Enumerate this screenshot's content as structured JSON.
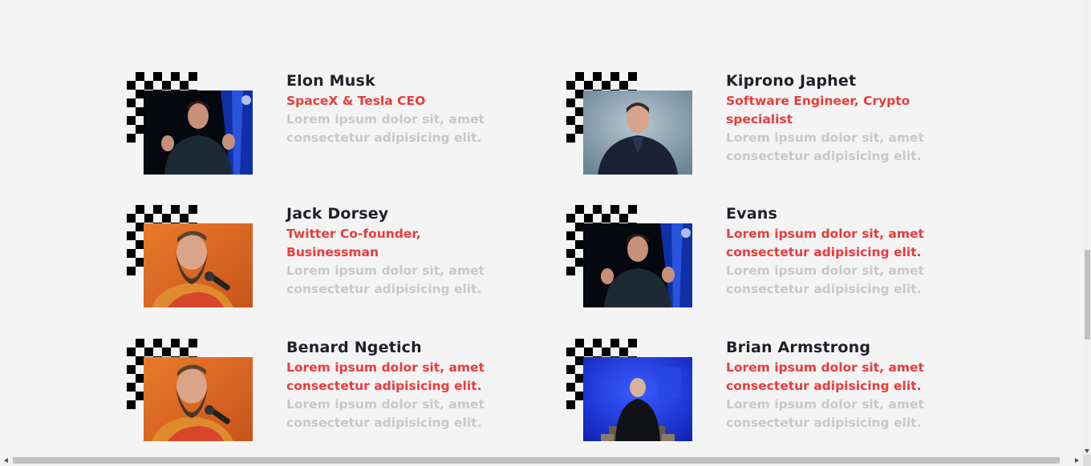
{
  "team": [
    {
      "name": "Elon Musk",
      "role": "SpaceX & Tesla CEO",
      "description": "Lorem ipsum dolor sit, amet consectetur adipisicing elit.",
      "photo": "person-on-stage-dark"
    },
    {
      "name": "Kiprono Japhet",
      "role": "Software Engineer, Crypto specialist",
      "description": "Lorem ipsum dolor sit, amet consectetur adipisicing elit.",
      "photo": "person-portrait-grey"
    },
    {
      "name": "Jack Dorsey",
      "role": "Twitter Co-founder, Businessman",
      "description": "Lorem ipsum dolor sit, amet consectetur adipisicing elit.",
      "photo": "bearded-speaker-orange"
    },
    {
      "name": "Evans",
      "role": "Lorem ipsum dolor sit, amet consectetur adipisicing elit.",
      "description": "Lorem ipsum dolor sit, amet consectetur adipisicing elit.",
      "photo": "person-on-stage-dark"
    },
    {
      "name": "Benard Ngetich",
      "role": "Lorem ipsum dolor sit, amet consectetur adipisicing elit.",
      "description": "Lorem ipsum dolor sit, amet consectetur adipisicing elit.",
      "photo": "bearded-speaker-orange"
    },
    {
      "name": "Brian Armstrong",
      "role": "Lorem ipsum dolor sit, amet consectetur adipisicing elit.",
      "description": "Lorem ipsum dolor sit, amet consectetur adipisicing elit.",
      "photo": "seated-speaker-blue"
    }
  ],
  "colors": {
    "background": "#f4f4f4",
    "name": "#1f2129",
    "role": "#ec3b3b",
    "description": "#c8c8c8",
    "checker": "#000000"
  }
}
